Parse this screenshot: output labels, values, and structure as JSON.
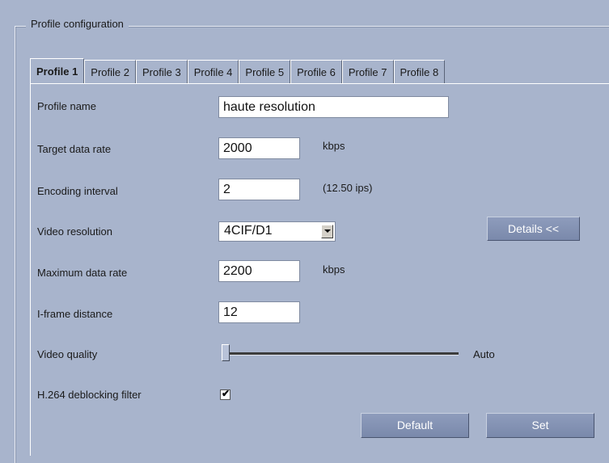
{
  "group": {
    "legend": "Profile configuration"
  },
  "tabs": [
    {
      "label": "Profile 1",
      "active": true
    },
    {
      "label": "Profile 2",
      "active": false
    },
    {
      "label": "Profile 3",
      "active": false
    },
    {
      "label": "Profile 4",
      "active": false
    },
    {
      "label": "Profile 5",
      "active": false
    },
    {
      "label": "Profile 6",
      "active": false
    },
    {
      "label": "Profile 7",
      "active": false
    },
    {
      "label": "Profile 8",
      "active": false
    }
  ],
  "form": {
    "profile_name": {
      "label": "Profile name",
      "value": "haute resolution"
    },
    "target_data_rate": {
      "label": "Target data rate",
      "value": "2000",
      "unit": "kbps"
    },
    "encoding_interval": {
      "label": "Encoding interval",
      "value": "2",
      "note": "(12.50 ips)"
    },
    "video_resolution": {
      "label": "Video resolution",
      "value": "4CIF/D1"
    },
    "maximum_data_rate": {
      "label": "Maximum data rate",
      "value": "2200",
      "unit": "kbps"
    },
    "iframe_distance": {
      "label": "I-frame distance",
      "value": "12"
    },
    "video_quality": {
      "label": "Video quality",
      "value_text": "Auto",
      "level": 0
    },
    "deblocking": {
      "label": "H.264 deblocking filter",
      "checked": true,
      "mark": "✔"
    }
  },
  "buttons": {
    "details": "Details <<",
    "default": "Default",
    "set": "Set"
  },
  "colors": {
    "background": "#a8b4cc",
    "button": "#7f8db0"
  }
}
